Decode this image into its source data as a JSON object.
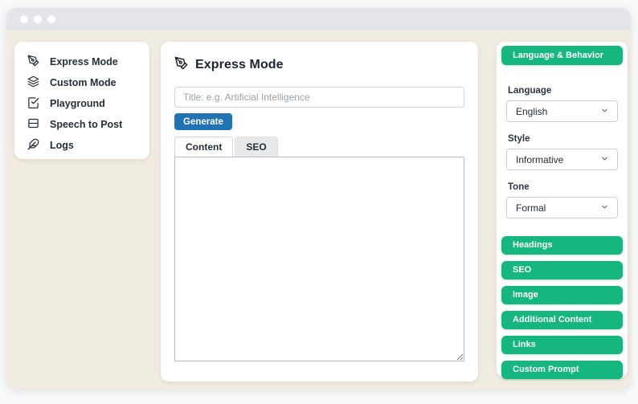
{
  "window": {
    "controls_count": 3
  },
  "sidebar": {
    "items": [
      {
        "label": "Express Mode",
        "icon": "pen-tool-icon"
      },
      {
        "label": "Custom Mode",
        "icon": "layers-icon"
      },
      {
        "label": "Playground",
        "icon": "check-square-icon"
      },
      {
        "label": "Speech to Post",
        "icon": "card-icon"
      },
      {
        "label": "Logs",
        "icon": "feather-icon"
      }
    ]
  },
  "main": {
    "title": "Express Mode",
    "title_icon": "pen-tool-icon",
    "title_input": {
      "value": "",
      "placeholder": "Title: e.g. Artificial Intelligence"
    },
    "generate_label": "Generate",
    "tabs": [
      {
        "label": "Content",
        "active": true
      },
      {
        "label": "SEO",
        "active": false
      }
    ],
    "content_textarea_value": ""
  },
  "panel": {
    "header": "Language & Behavior",
    "fields": [
      {
        "label": "Language",
        "value": "English"
      },
      {
        "label": "Style",
        "value": "Informative"
      },
      {
        "label": "Tone",
        "value": "Formal"
      }
    ],
    "buttons": [
      "Headings",
      "SEO",
      "Image",
      "Additional Content",
      "Links",
      "Custom Prompt"
    ]
  },
  "colors": {
    "accent_green": "#16b67f",
    "accent_blue": "#2173b4",
    "window_body_bg": "#f1ece1",
    "titlebar_bg": "#e3e5e8"
  }
}
